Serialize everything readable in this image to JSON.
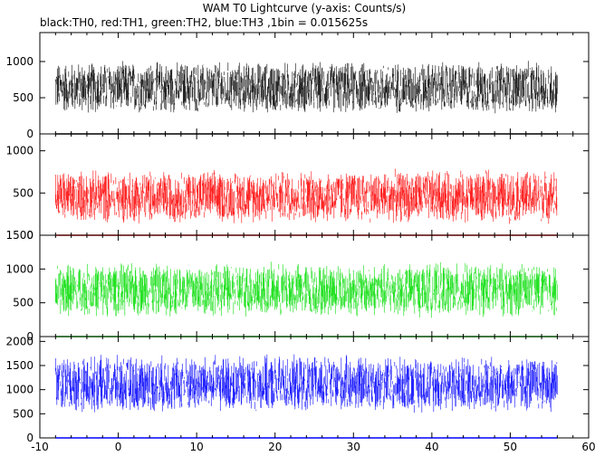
{
  "chart_data": {
    "type": "line",
    "title": "WAM T0 Lightcurve (y-axis: Counts/s)",
    "subtitle": "black:TH0, red:TH1, green:TH2, blue:TH3 ,1bin = 0.015625s",
    "xlabel": "",
    "ylabel": "",
    "x_range": [
      -10,
      60
    ],
    "x_data_range": [
      -8,
      56
    ],
    "x_ticks": [
      "-10",
      "0",
      "10",
      "20",
      "30",
      "40",
      "50",
      "60"
    ],
    "grid": false,
    "panels": [
      {
        "name": "TH0",
        "color": "#000000",
        "ylim": [
          0,
          1400
        ],
        "y_ticks": [
          "0",
          "500",
          "1000"
        ],
        "level": {
          "mean": 640,
          "spread": 380
        },
        "tick_values": [
          0,
          500,
          1000
        ]
      },
      {
        "name": "TH1",
        "color": "#ff0000",
        "ylim": [
          0,
          1200
        ],
        "y_ticks": [
          "0",
          "500",
          "1000"
        ],
        "level": {
          "mean": 460,
          "spread": 330
        },
        "tick_values": [
          0,
          500,
          1000
        ]
      },
      {
        "name": "TH2",
        "color": "#00dd00",
        "ylim": [
          0,
          1500
        ],
        "y_ticks": [
          "0",
          "500",
          "1000",
          "1500"
        ],
        "level": {
          "mean": 690,
          "spread": 420
        },
        "tick_values": [
          0,
          500,
          1000,
          1500
        ]
      },
      {
        "name": "TH3",
        "color": "#0000ff",
        "ylim": [
          0,
          2100
        ],
        "y_ticks": [
          "0",
          "500",
          "1000",
          "1500",
          "2000"
        ],
        "level": {
          "mean": 1120,
          "spread": 620
        },
        "tick_values": [
          0,
          500,
          1000,
          1500,
          2000
        ]
      }
    ]
  }
}
